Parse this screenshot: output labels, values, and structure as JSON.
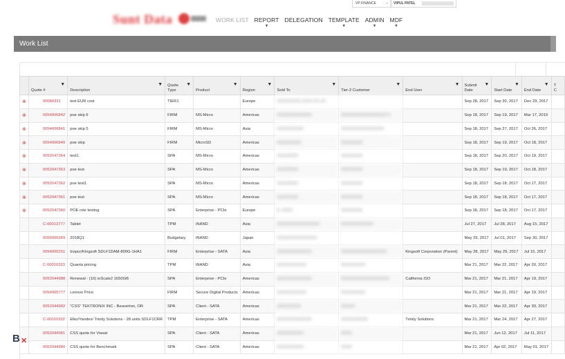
{
  "header": {
    "logo_text": "Sunt Data",
    "nav": [
      {
        "label": "WORK LIST",
        "caret": false
      },
      {
        "label": "REPORT",
        "caret": true
      },
      {
        "label": "DELEGATION",
        "caret": false
      },
      {
        "label": "TEMPLATE",
        "caret": true
      },
      {
        "label": "ADMIN",
        "caret": true
      },
      {
        "label": "MDF",
        "caret": true
      }
    ],
    "company": "VP FINANCE",
    "user": "VIPUL PATEL"
  },
  "worklist": {
    "title": "Work List",
    "columns": [
      "",
      "Quote #",
      "Description",
      "Quote Type",
      "Product",
      "Region",
      "Sold To",
      "Tier-2 Customer",
      "End User",
      "Submit Date",
      "Start Date",
      "End Date",
      "T C"
    ],
    "rows": [
      {
        "quote": "00080331",
        "desc": "test EUR cost",
        "type": "TIER1",
        "product": "",
        "region": "Europe",
        "sold_to": "XXXXXXXXX XXXX XX XX",
        "tier2": "",
        "end_user": "",
        "submit": "Sep 28, 2017",
        "start": "Sep 30, 2017",
        "end": "Dec 29, 2017",
        "icon": true
      },
      {
        "quote": "0054006842",
        "desc": "poe skip 6",
        "type": "FIRM",
        "product": "MS-Micro",
        "region": "Americas",
        "sold_to": "XXXXXXXXXXXXX",
        "tier2": "XXXXXXXXXXXXXXXXX S",
        "end_user": "",
        "submit": "Sep 18, 2017",
        "start": "Sep 19, 2017",
        "end": "Mar 17, 2019",
        "icon": true
      },
      {
        "quote": "0054006841",
        "desc": "poe skip 5",
        "type": "FIRM",
        "product": "MS-Micro",
        "region": "Asia",
        "sold_to": "XXXXXXXXXX",
        "tier2": "XXXXXXXXXXXXXXXX",
        "end_user": "",
        "submit": "Sep 18, 2017",
        "start": "Sep 27, 2017",
        "end": "Oct 26, 2017",
        "icon": true
      },
      {
        "quote": "0054006840",
        "desc": "poe skip",
        "type": "FIRM",
        "product": "MicroSD",
        "region": "Americas",
        "sold_to": "XXXXXXXXX",
        "tier2": "XXXXXXXX",
        "end_user": "",
        "submit": "Sep 18, 2017",
        "start": "Sep 19, 2017",
        "end": "Oct 18, 2017",
        "icon": true
      },
      {
        "quote": "0052047364",
        "desc": "test1",
        "type": "SPA",
        "product": "MS-Micro",
        "region": "Americas",
        "sold_to": "XXXXXXXX",
        "tier2": "XXXXXXXX",
        "end_user": "",
        "submit": "Sep 18, 2017",
        "start": "Sep 20, 2017",
        "end": "Oct 19, 2017",
        "icon": true
      },
      {
        "quote": "0052047363",
        "desc": "poe test",
        "type": "SPA",
        "product": "MS-Micro",
        "region": "Americas",
        "sold_to": "XXXXXXXX",
        "tier2": "XXXXXXXX",
        "end_user": "",
        "submit": "Sep 18, 2017",
        "start": "Sep 19, 2017",
        "end": "Oct 18, 2017",
        "icon": true
      },
      {
        "quote": "0052047362",
        "desc": "poe test1",
        "type": "SPA",
        "product": "MS-Micro",
        "region": "Americas",
        "sold_to": "XXXXXXXX",
        "tier2": "XXXXXXXX",
        "end_user": "",
        "submit": "Sep 18, 2017",
        "start": "Sep 18, 2017",
        "end": "Oct 17, 2017",
        "icon": true
      },
      {
        "quote": "0052047361",
        "desc": "poe test",
        "type": "SPA",
        "product": "MS-Micro",
        "region": "Americas",
        "sold_to": "XXXXXXXX",
        "tier2": "XXXXXXXX",
        "end_user": "",
        "submit": "Sep 18, 2017",
        "start": "Sep 18, 2017",
        "end": "Oct 17, 2017",
        "icon": true
      },
      {
        "quote": "0052047360",
        "desc": "POE role testing",
        "type": "SPA",
        "product": "Enterprise - PCIe",
        "region": "Europe",
        "sold_to": "A. XXXX",
        "tier2": "XXXXXXXX",
        "end_user": "",
        "submit": "Sep 18, 2017",
        "start": "Sep 18, 2017",
        "end": "Oct 17, 2017",
        "icon": true
      },
      {
        "quote": "C-00013777",
        "desc": "Tablet",
        "type": "TPM",
        "product": "iNAND",
        "region": "Asia",
        "sold_to": "XXXXXXXXXXXXXXXX",
        "tier2": "XXXXXXXXXXXX",
        "end_user": "",
        "submit": "Jul 27, 2017",
        "start": "Jul 28, 2017",
        "end": "Aug 15, 2017",
        "icon": false
      },
      {
        "quote": "0055006369",
        "desc": "2018Q1",
        "type": "Budgetary",
        "product": "iNAND",
        "region": "Japan",
        "sold_to": "XXXXXXXXXXXXXXX",
        "tier2": "",
        "end_user": "",
        "submit": "May 29, 2017",
        "start": "Jul 01, 2017",
        "end": "Sep 30, 2017",
        "icon": false
      },
      {
        "quote": "0054006251",
        "desc": "Inspur/Kingsoft SDLF1DAM-800G-1HA1",
        "type": "FIRM",
        "product": "Enterprise - SATA",
        "region": "Asia",
        "sold_to": "XXXXXXXXXXXXX",
        "tier2": "XXXXXXXXXXXXXXXXX",
        "end_user": "Kingsoft Corporation (Parent)",
        "submit": "May 28, 2017",
        "start": "May 29, 2017",
        "end": "Jul 15, 2017",
        "icon": false
      },
      {
        "quote": "C-00010333",
        "desc": "Quanta pricing",
        "type": "TPM",
        "product": "iNAND",
        "region": "Asia",
        "sold_to": "XXXXXXXXXXX",
        "tier2": "XXXXXXXXX",
        "end_user": "",
        "submit": "Mar 21, 2017",
        "start": "Mar 22, 2017",
        "end": "Apr 20, 2017",
        "icon": false
      },
      {
        "quote": "0052044988",
        "desc": "Renewal - (16) ioScale2 1650GB",
        "type": "SPA",
        "product": "Enterprise - PCIe",
        "region": "Americas",
        "sold_to": "XXXXXXXXXXXXX",
        "tier2": "XXXXXXXXXXXXXXXXXX",
        "end_user": "California ISO",
        "submit": "Mar 21, 2017",
        "start": "Mar 21, 2017",
        "end": "Apr 19, 2017",
        "icon": false
      },
      {
        "quote": "0054005777",
        "desc": "Lenovo Price",
        "type": "FIRM",
        "product": "Secure Digital Products",
        "region": "Americas",
        "sold_to": "XXXXXXXXXXX",
        "tier2": "XXXXXXXXX",
        "end_user": "",
        "submit": "Mar 21, 2017",
        "start": "Mar 21, 2017",
        "end": "Apr 19, 2017",
        "icon": false
      },
      {
        "quote": "0052044982",
        "desc": "\"CSS\" TEKTRONIX INC - Beaverton, OR",
        "type": "SPA",
        "product": "Client - SATA",
        "region": "Americas",
        "sold_to": "XXXXXXXXX",
        "tier2": "XXXXX",
        "end_user": "",
        "submit": "Mar 21, 2017",
        "start": "Mar 22, 2017",
        "end": "Apr 30, 2017",
        "icon": false
      },
      {
        "quote": "C-00010332",
        "desc": "Elko/Yandex/ Trinity Solutions - 28 units SDLF1CRR",
        "type": "TPM",
        "product": "Enterprise - SATA",
        "region": "Americas",
        "sold_to": "XXXXXXXXXXXXX",
        "tier2": "XXXXXXXXXX",
        "end_user": "Trinity Solutions",
        "submit": "Mar 21, 2017",
        "start": "Mar 24, 2017",
        "end": "Apr 27, 2017",
        "icon": false
      },
      {
        "quote": "0052044981",
        "desc": "CSS quote for Viasat",
        "type": "SPA",
        "product": "Client - SATA",
        "region": "Americas",
        "sold_to": "XXXXXXXXXX",
        "tier2": "XXXX",
        "end_user": "",
        "submit": "Mar 21, 2017",
        "start": "Jun 12, 2017",
        "end": "Jul 11, 2017",
        "icon": false
      },
      {
        "quote": "0052044980",
        "desc": "CSS quote for Benchmark",
        "type": "SPA",
        "product": "Client - SATA",
        "region": "Americas",
        "sold_to": "XXXXXXXXXX",
        "tier2": "XXXX",
        "end_user": "",
        "submit": "Mar 21, 2017",
        "start": "Apr 02, 2017",
        "end": "May 01, 2017",
        "icon": false
      }
    ]
  }
}
